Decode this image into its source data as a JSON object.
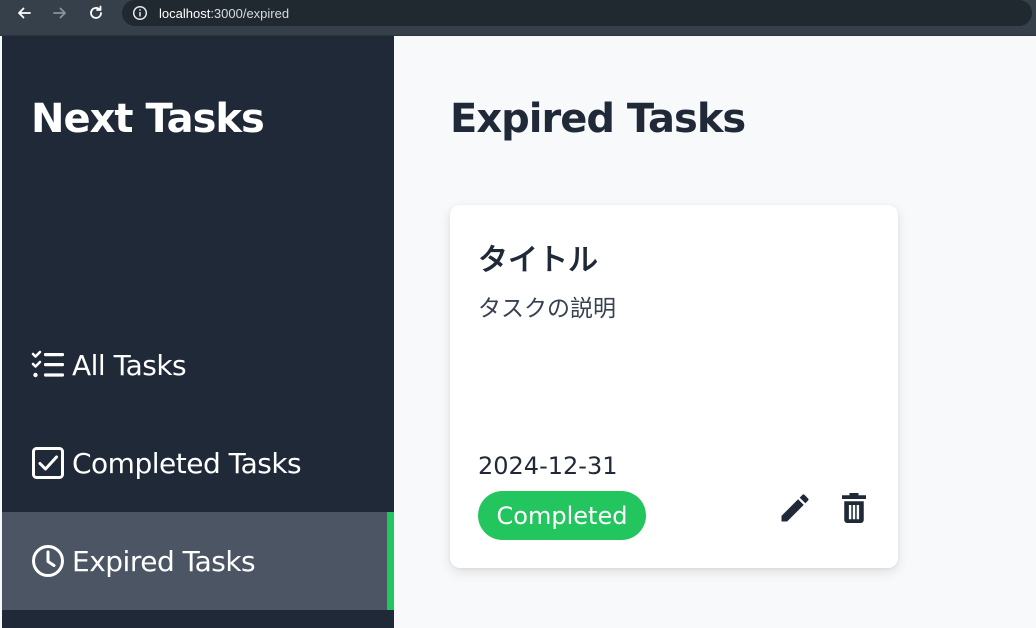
{
  "browser": {
    "url_host": "localhost",
    "url_path": ":3000/expired"
  },
  "sidebar": {
    "brand": "Next Tasks",
    "items": [
      {
        "label": "All Tasks",
        "icon": "checklist-icon",
        "active": false
      },
      {
        "label": "Completed Tasks",
        "icon": "checkbox-icon",
        "active": false
      },
      {
        "label": "Expired Tasks",
        "icon": "clock-icon",
        "active": true
      }
    ]
  },
  "main": {
    "title": "Expired Tasks",
    "tasks": [
      {
        "title": "タイトル",
        "description": "タスクの説明",
        "date": "2024-12-31",
        "status": "Completed"
      }
    ]
  },
  "colors": {
    "sidebar_bg": "#1f2937",
    "active_item_bg": "#4b5563",
    "accent_green": "#22c55e",
    "page_bg": "#f8f9fa"
  }
}
